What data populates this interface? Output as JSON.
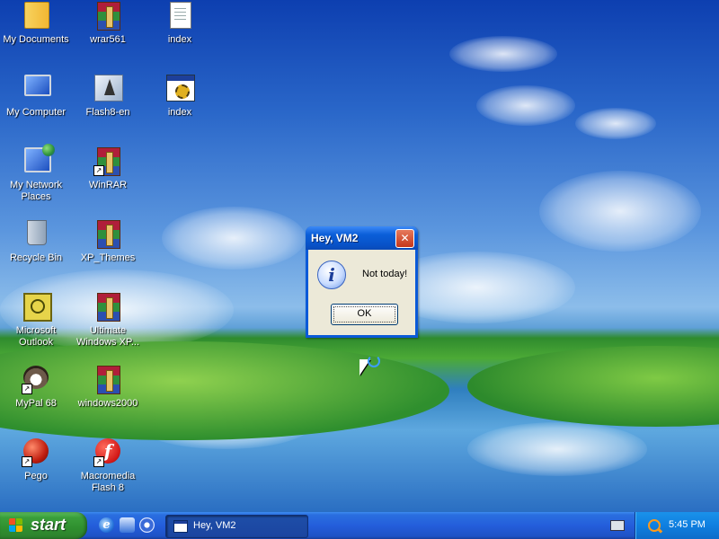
{
  "desktop": {
    "icons": [
      {
        "label": "My Documents",
        "icon": "folder-icon"
      },
      {
        "label": "wrar561",
        "icon": "winrar-archive-icon"
      },
      {
        "label": "index",
        "icon": "text-document-icon"
      },
      {
        "label": "My Computer",
        "icon": "computer-icon"
      },
      {
        "label": "Flash8-en",
        "icon": "installer-icon"
      },
      {
        "label": "index",
        "icon": "setup-window-icon"
      },
      {
        "label": "My Network Places",
        "icon": "network-places-icon"
      },
      {
        "label": "WinRAR",
        "icon": "winrar-shortcut-icon"
      },
      {
        "label": "Recycle Bin",
        "icon": "recycle-bin-icon"
      },
      {
        "label": "XP_Themes",
        "icon": "winrar-archive-icon"
      },
      {
        "label": "Microsoft Outlook",
        "icon": "outlook-icon"
      },
      {
        "label": "Ultimate Windows XP...",
        "icon": "winrar-archive-icon"
      },
      {
        "label": "MyPal 68",
        "icon": "mypal-icon"
      },
      {
        "label": "windows2000",
        "icon": "winrar-archive-icon"
      },
      {
        "label": "Pego",
        "icon": "pego-icon"
      },
      {
        "label": "Macromedia Flash 8",
        "icon": "flash-icon"
      }
    ]
  },
  "dialog": {
    "title": "Hey, VM2",
    "close_glyph": "✕",
    "message": "Not today!",
    "ok_label": "OK",
    "icon": "information-icon"
  },
  "taskbar": {
    "start_label": "start",
    "task_button_label": "Hey, VM2",
    "clock": "5:45 PM",
    "quick_launch": [
      "internet-explorer-icon",
      "show-desktop-icon",
      "media-player-icon"
    ]
  }
}
